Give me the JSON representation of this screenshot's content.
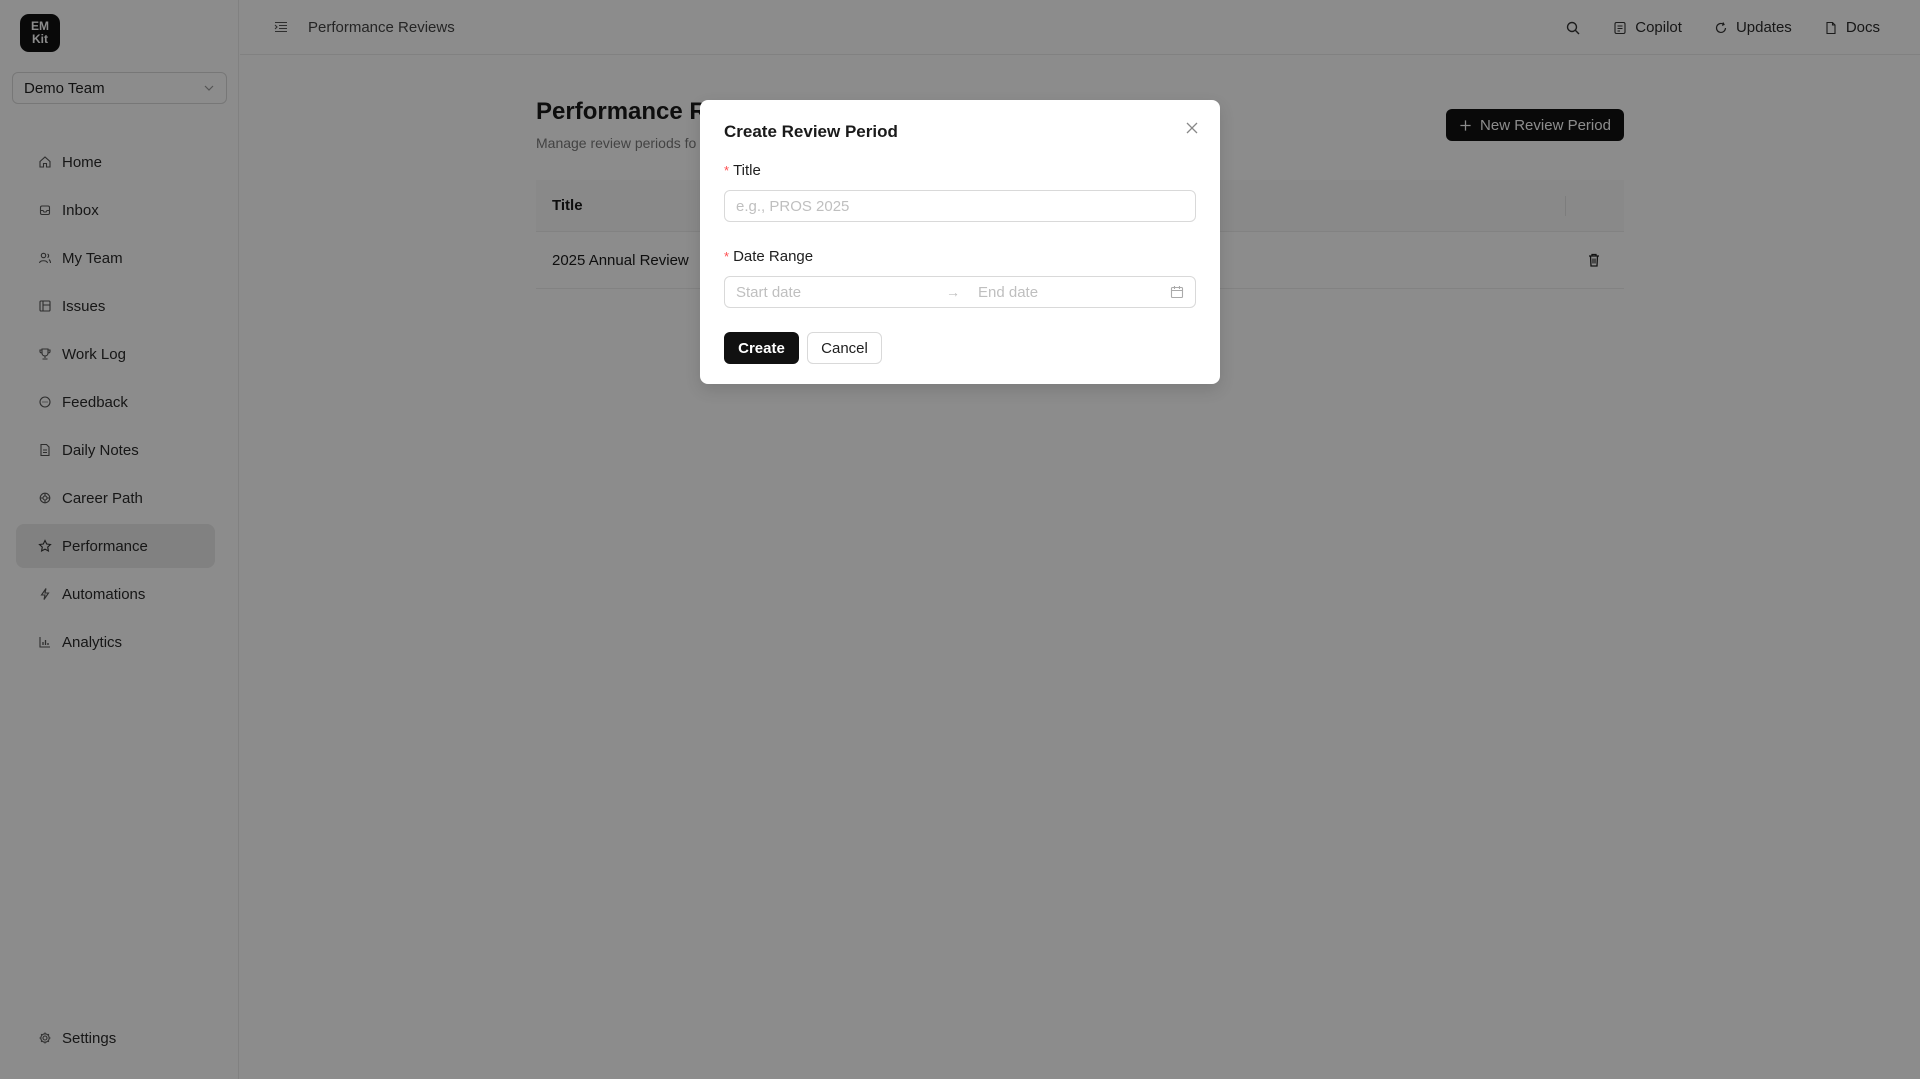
{
  "app": {
    "logo_line1": "EM",
    "logo_line2": "Kit"
  },
  "sidebar": {
    "team_select": "Demo Team",
    "items": [
      {
        "label": "Home",
        "icon": "home-icon"
      },
      {
        "label": "Inbox",
        "icon": "inbox-icon"
      },
      {
        "label": "My Team",
        "icon": "team-icon"
      },
      {
        "label": "Issues",
        "icon": "issues-icon"
      },
      {
        "label": "Work Log",
        "icon": "trophy-icon"
      },
      {
        "label": "Feedback",
        "icon": "feedback-icon"
      },
      {
        "label": "Daily Notes",
        "icon": "notes-icon"
      },
      {
        "label": "Career Path",
        "icon": "career-icon"
      },
      {
        "label": "Performance",
        "icon": "star-icon",
        "active": true
      },
      {
        "label": "Automations",
        "icon": "bolt-icon"
      },
      {
        "label": "Analytics",
        "icon": "chart-icon"
      }
    ],
    "settings_label": "Settings"
  },
  "header": {
    "breadcrumb": "Performance Reviews",
    "copilot": "Copilot",
    "updates": "Updates",
    "docs": "Docs"
  },
  "main": {
    "title": "Performance Re",
    "subtitle": "Manage review periods fo",
    "new_button": "New Review Period",
    "table": {
      "header_title": "Title",
      "rows": [
        {
          "title": "2025 Annual Review"
        }
      ]
    }
  },
  "modal": {
    "title": "Create Review Period",
    "title_label": "Title",
    "title_placeholder": "e.g., PROS 2025",
    "range_label": "Date Range",
    "start_placeholder": "Start date",
    "end_placeholder": "End date",
    "arrow": "→",
    "required_mark": "*",
    "create": "Create",
    "cancel": "Cancel"
  },
  "colors": {
    "primary": "#111111",
    "required": "#ff4d4f",
    "active_nav_bg": "#ebebeb"
  }
}
